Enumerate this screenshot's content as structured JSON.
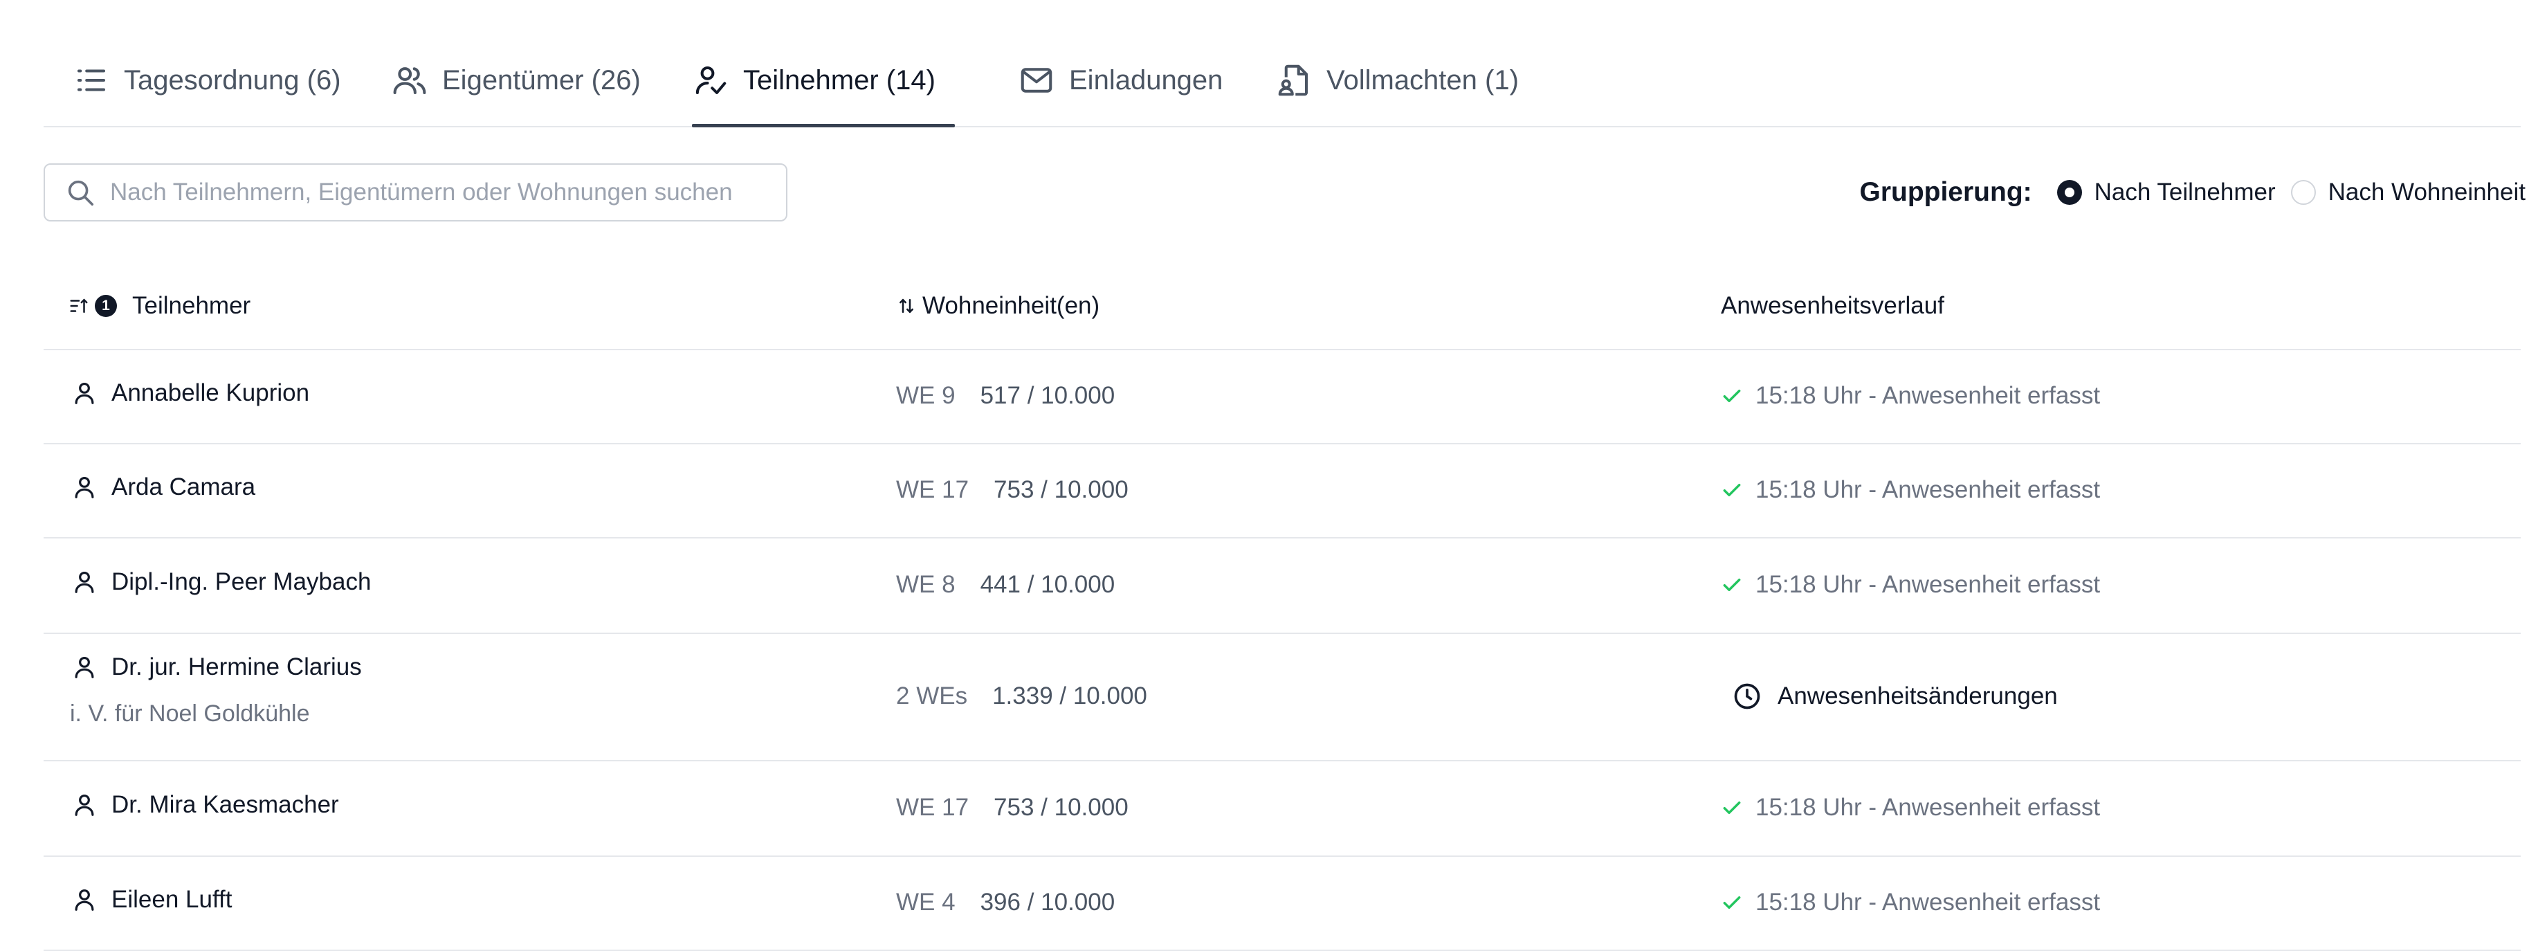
{
  "tabs": [
    {
      "label": "Tagesordnung (6)",
      "icon": "list-icon",
      "active": false
    },
    {
      "label": "Eigentümer (26)",
      "icon": "users-icon",
      "active": false
    },
    {
      "label": "Teilnehmer (14)",
      "icon": "user-check-icon",
      "active": true
    },
    {
      "label": "Einladungen",
      "icon": "mail-icon",
      "active": false
    },
    {
      "label": "Vollmachten (1)",
      "icon": "document-user-icon",
      "active": false
    }
  ],
  "search": {
    "placeholder": "Nach Teilnehmern, Eigentümern oder Wohnungen suchen",
    "value": ""
  },
  "grouping": {
    "label": "Gruppierung:",
    "options": [
      "Nach Teilnehmer",
      "Nach Wohneinheit"
    ],
    "selected": "Nach Teilnehmer"
  },
  "table": {
    "columns": {
      "participant": "Teilnehmer",
      "sort_badge": "1",
      "units": "Wohneinheit(en)",
      "attendance": "Anwesenheitsverlauf"
    },
    "rows": [
      {
        "name": "Annabelle Kuprion",
        "sub": "",
        "unit": "WE 9",
        "share": "517 / 10.000",
        "status": "15:18 Uhr - Anwesenheit erfasst",
        "status_type": "ok"
      },
      {
        "name": "Arda Camara",
        "sub": "",
        "unit": "WE 17",
        "share": "753 / 10.000",
        "status": "15:18 Uhr - Anwesenheit erfasst",
        "status_type": "ok"
      },
      {
        "name": "Dipl.-Ing. Peer Maybach",
        "sub": "",
        "unit": "WE 8",
        "share": "441 / 10.000",
        "status": "15:18 Uhr - Anwesenheit erfasst",
        "status_type": "ok"
      },
      {
        "name": "Dr. jur. Hermine Clarius",
        "sub": "i. V. für Noel Goldkühle",
        "unit": "2 WEs",
        "share": "1.339 / 10.000",
        "status": "Anwesenheitsänderungen",
        "status_type": "changes"
      },
      {
        "name": "Dr. Mira Kaesmacher",
        "sub": "",
        "unit": "WE 17",
        "share": "753 / 10.000",
        "status": "15:18 Uhr - Anwesenheit erfasst",
        "status_type": "ok"
      },
      {
        "name": "Eileen Lufft",
        "sub": "",
        "unit": "WE 4",
        "share": "396 / 10.000",
        "status": "15:18 Uhr - Anwesenheit erfasst",
        "status_type": "ok"
      }
    ]
  },
  "colors": {
    "success": "#22c55e",
    "text_primary": "#111827",
    "text_muted": "#6b7280",
    "border": "#e5e7eb"
  }
}
